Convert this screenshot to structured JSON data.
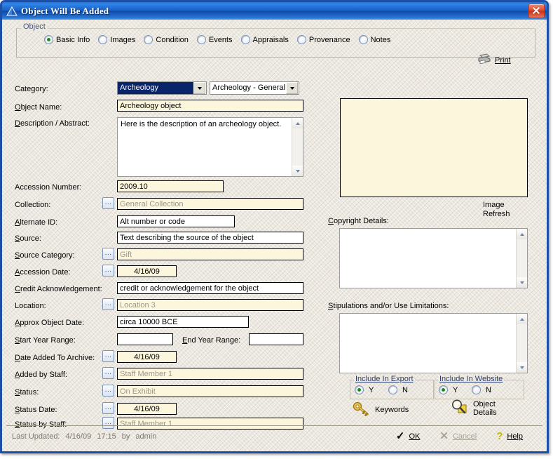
{
  "window": {
    "title": "Object Will Be Added",
    "icon": "triangle-icon",
    "close_label": "×",
    "accent_color": "#1c50a8",
    "background_color": "#e9e5dc",
    "field_color": "#fcf7dc"
  },
  "group": {
    "legend": "Object",
    "tabs": [
      {
        "label": "Basic Info",
        "selected": true
      },
      {
        "label": "Images",
        "selected": false
      },
      {
        "label": "Condition",
        "selected": false
      },
      {
        "label": "Events",
        "selected": false
      },
      {
        "label": "Appraisals",
        "selected": false
      },
      {
        "label": "Provenance",
        "selected": false
      },
      {
        "label": "Notes",
        "selected": false
      }
    ],
    "print_label": "Print"
  },
  "form": {
    "category": {
      "label": "Category:",
      "value": "Archeology",
      "selected": true,
      "sub_value": "Archeology - General"
    },
    "object_name": {
      "label": "Object Name:",
      "value": "Archeology object"
    },
    "description": {
      "label": "Description / Abstract:",
      "value": "Here is the description of an archeology object."
    },
    "accession_number": {
      "label": "Accession Number:",
      "value": "2009.10"
    },
    "collection": {
      "label": "Collection:",
      "value": "General Collection",
      "browse": "...",
      "lookup": true
    },
    "alternate_id": {
      "label": "Alternate ID:",
      "value": "Alt number or code"
    },
    "source": {
      "label": "Source:",
      "value": "Text describing the source of the object"
    },
    "source_category": {
      "label": "Source Category:",
      "value": "Gift",
      "browse": "...",
      "lookup": true
    },
    "accession_date": {
      "label": "Accession Date:",
      "value": "4/16/09",
      "browse": "...",
      "lookup": true
    },
    "credit": {
      "label": "Credit Acknowledgement:",
      "value": "credit or acknowledgement for the object"
    },
    "location": {
      "label": "Location:",
      "value": "Location 3",
      "browse": "...",
      "lookup": true
    },
    "approx_date": {
      "label": "Approx Object Date:",
      "value": "circa 10000 BCE"
    },
    "start_year": {
      "label": "Start Year Range:",
      "value": ""
    },
    "end_year": {
      "label": "End Year Range:",
      "value": ""
    },
    "date_added": {
      "label": "Date Added To Archive:",
      "value": "4/16/09",
      "browse": "...",
      "lookup": true
    },
    "added_by": {
      "label": "Added by Staff:",
      "value": "Staff Member 1",
      "browse": "...",
      "lookup": true
    },
    "status": {
      "label": "Status:",
      "value": "On Exhibit",
      "browse": "...",
      "lookup": true
    },
    "status_date": {
      "label": "Status Date:",
      "value": "4/16/09",
      "browse": "...",
      "lookup": true
    },
    "status_by": {
      "label": "Status by Staff:",
      "value": "Staff Member 1",
      "browse": "...",
      "lookup": true
    }
  },
  "right": {
    "image_refresh_label_1": "Image",
    "image_refresh_label_2": "Refresh",
    "copyright": {
      "label": "Copyright Details:",
      "value": ""
    },
    "stipulations": {
      "label": "Stipulations and/or Use Limitations:",
      "value": ""
    },
    "include_export": {
      "legend": "Include In Export",
      "yes": "Y",
      "no": "N",
      "value": "Y"
    },
    "include_website": {
      "legend": "Include In Website",
      "yes": "Y",
      "no": "N",
      "value": "Y"
    },
    "keywords_label": "Keywords",
    "object_details_label_1": "Object",
    "object_details_label_2": "Details"
  },
  "statusbar": {
    "last_updated_label": "Last Updated:",
    "date": "4/16/09",
    "time": "17:15",
    "by_label": "by",
    "user": "admin",
    "ok_label": "OK",
    "cancel_label": "Cancel",
    "help_label": "Help"
  }
}
